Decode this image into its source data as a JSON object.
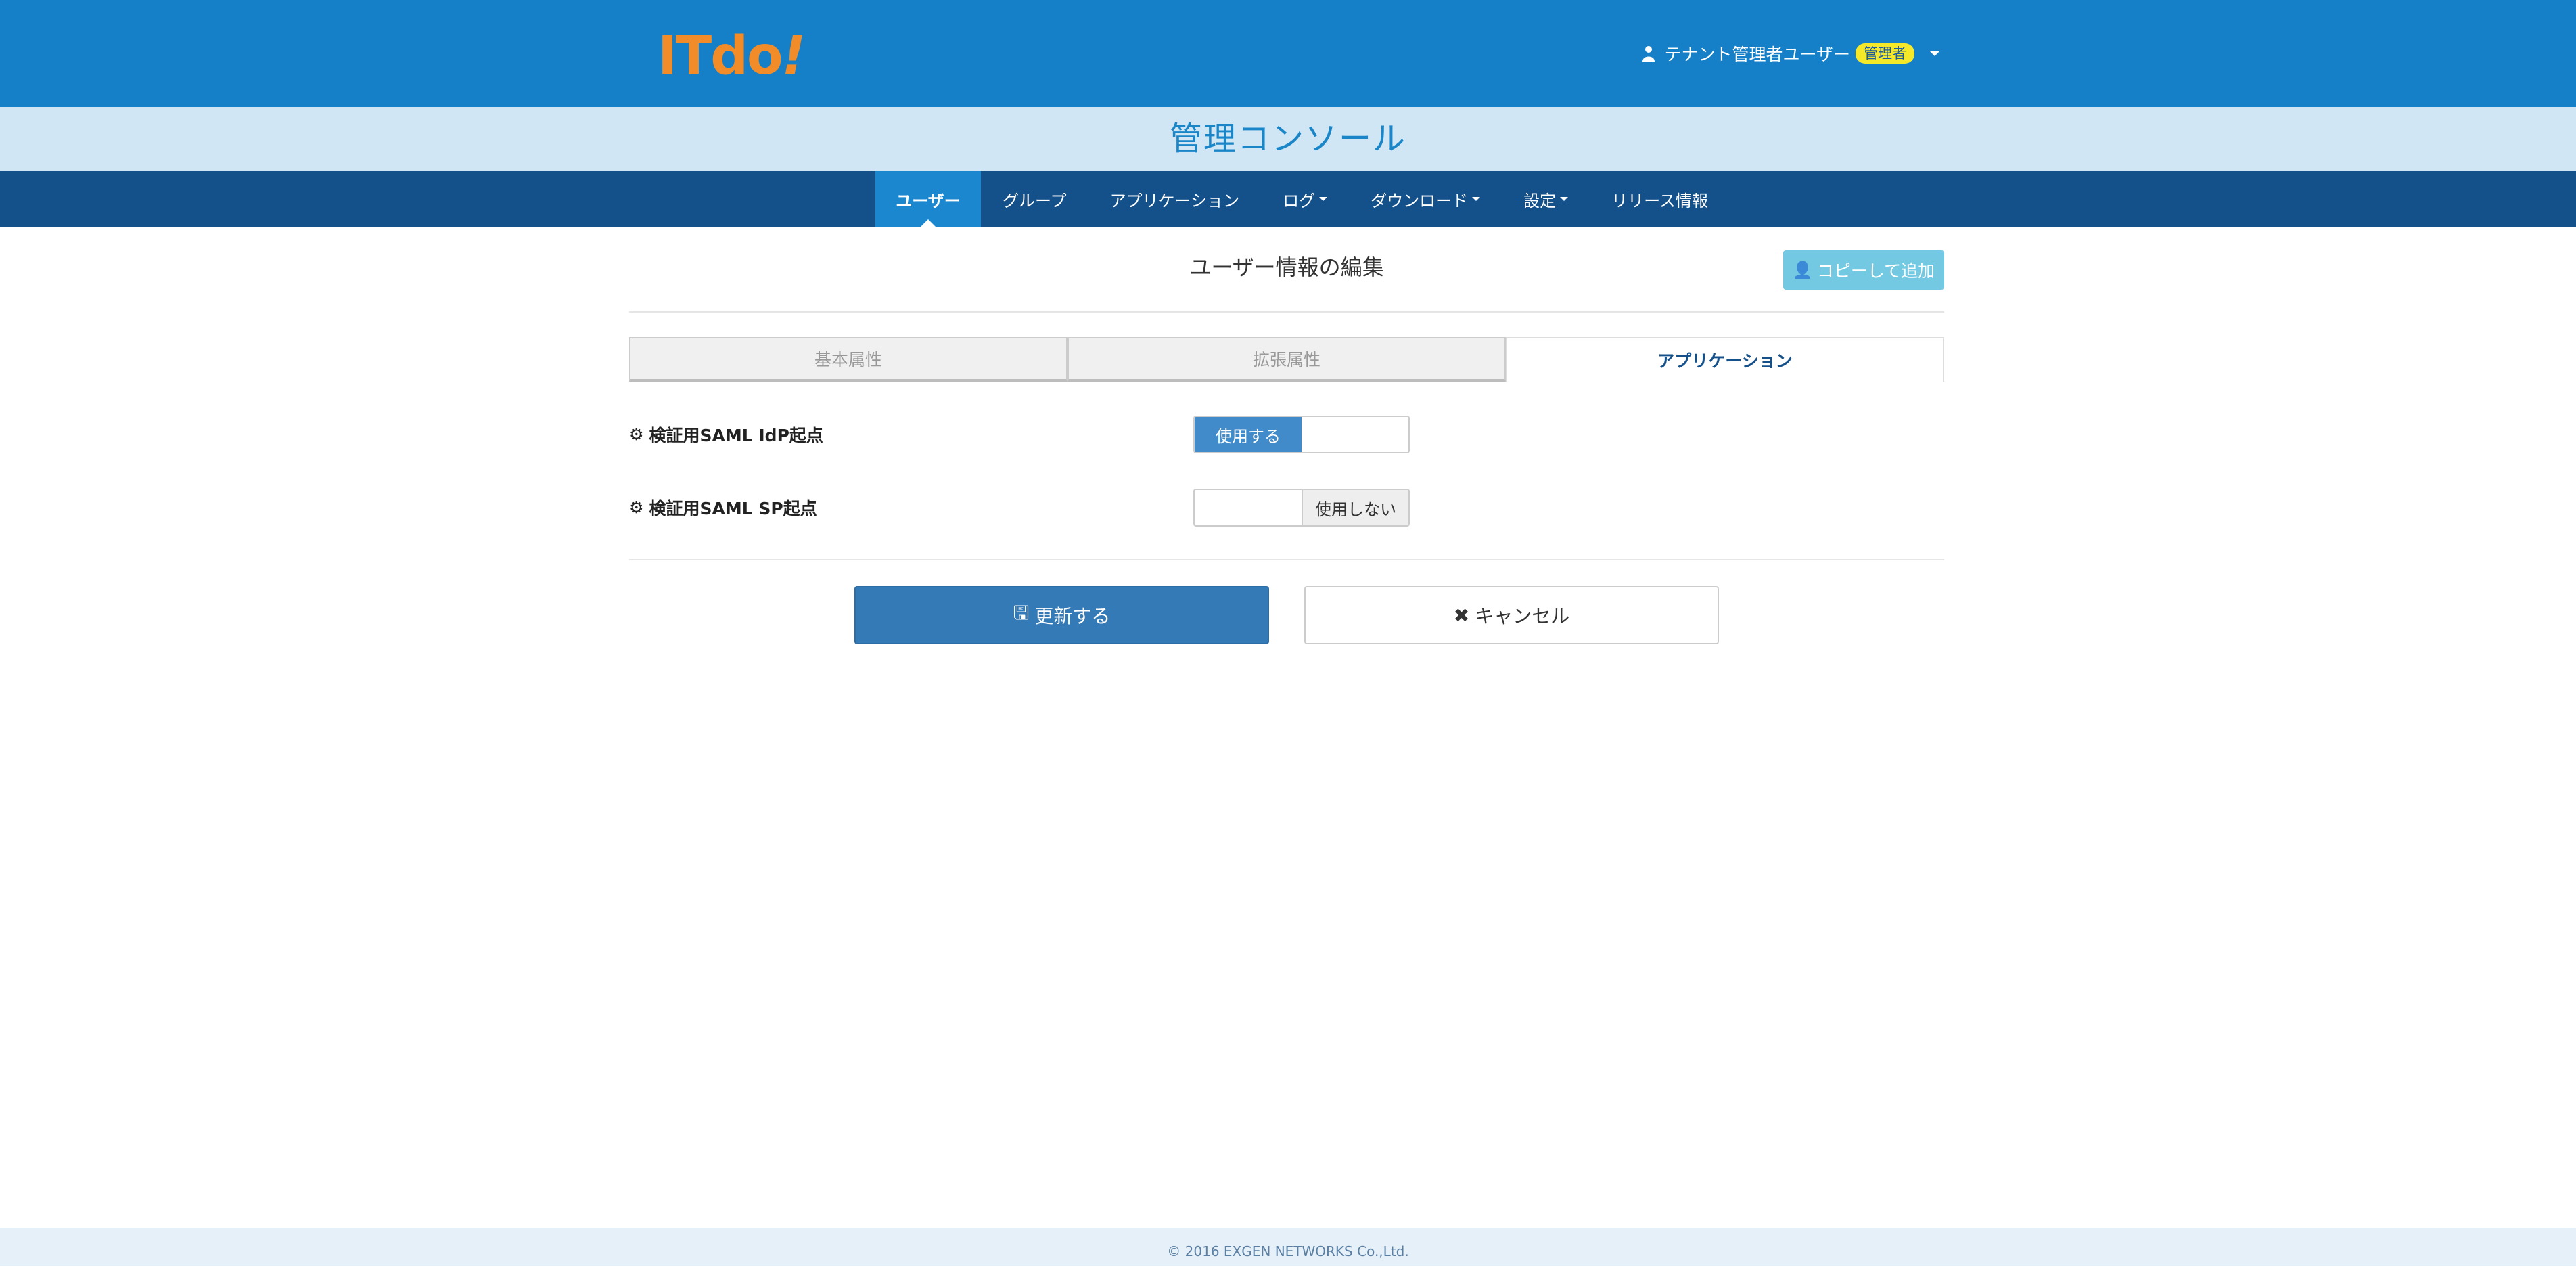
{
  "header": {
    "logo_text": "ITdo",
    "logo_bang": "!",
    "user_name": "テナント管理者ユーザー",
    "user_badge": "管理者"
  },
  "console_title": "管理コンソール",
  "nav": {
    "items": [
      {
        "label": "ユーザー",
        "active": true
      },
      {
        "label": "グループ"
      },
      {
        "label": "アプリケーション"
      },
      {
        "label": "ログ",
        "dropdown": true
      },
      {
        "label": "ダウンロード",
        "dropdown": true
      },
      {
        "label": "設定",
        "dropdown": true
      },
      {
        "label": "リリース情報"
      }
    ]
  },
  "page": {
    "heading": "ユーザー情報の編集",
    "copy_button": "コピーして追加",
    "tabs": [
      {
        "label": "基本属性"
      },
      {
        "label": "拡張属性"
      },
      {
        "label": "アプリケーション",
        "active": true
      }
    ],
    "settings": [
      {
        "label": "検証用SAML IdP起点",
        "on_label": "使用する",
        "state": "on"
      },
      {
        "label": "検証用SAML SP起点",
        "off_label": "使用しない",
        "state": "off"
      }
    ],
    "update_button": "更新する",
    "cancel_button": "キャンセル"
  },
  "footer": {
    "copyright": "© 2016 EXGEN NETWORKS Co.,Ltd."
  },
  "colors": {
    "header_blue": "#1580c8",
    "nav_navy": "#14508a",
    "title_bg": "#d0e6f5",
    "logo_orange": "#f28c28",
    "badge_yellow": "#f5e829",
    "primary": "#337ab7"
  }
}
